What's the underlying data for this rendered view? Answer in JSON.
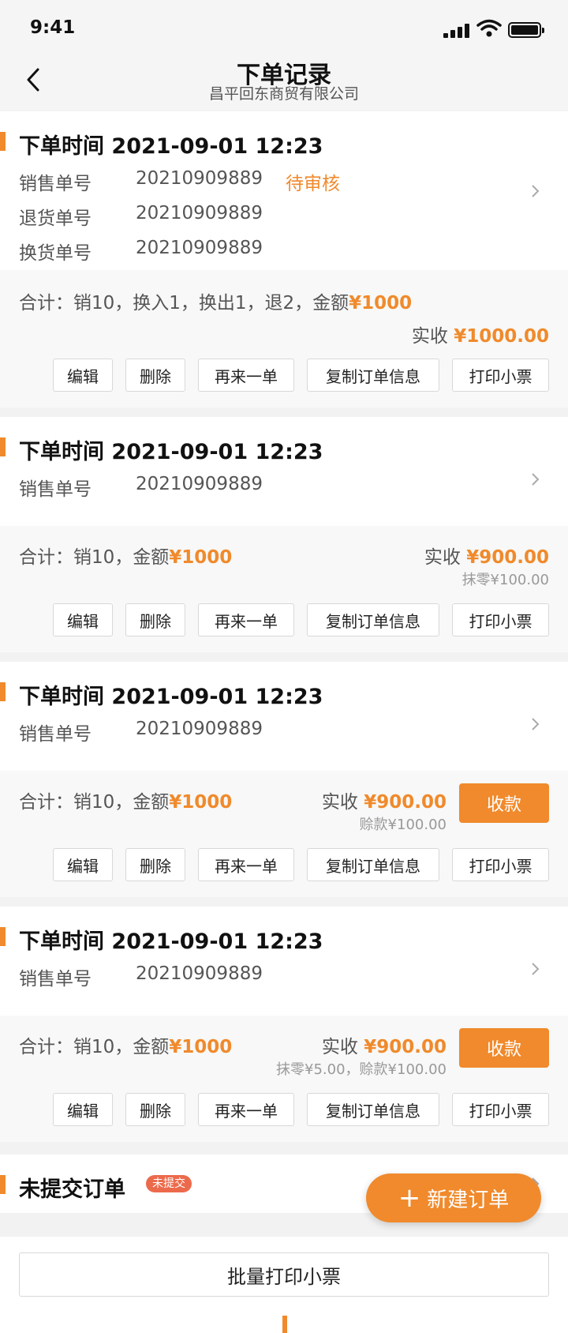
{
  "status": {
    "time": "9:41"
  },
  "nav": {
    "title": "下单记录",
    "subtitle": "昌平回东商贸有限公司"
  },
  "labels": {
    "order_time": "下单时间",
    "sale_no": "销售单号",
    "return_no": "退货单号",
    "exchange_no": "换货单号",
    "actual": "实收"
  },
  "orders": [
    {
      "time": "2021-09-01 12:23",
      "sale_no": "20210909889",
      "status": "待审核",
      "return_no": "20210909889",
      "exchange_no": "20210909889",
      "summary": "合计：销10，换入1，换出1，退2，金额",
      "amount": "¥1000",
      "actual": "¥1000.00",
      "note": ""
    },
    {
      "time": "2021-09-01 12:23",
      "sale_no": "20210909889",
      "summary": "合计：销10，金额",
      "amount": "¥1000",
      "actual": "¥900.00",
      "note": "抹零¥100.00"
    },
    {
      "time": "2021-09-01 12:23",
      "sale_no": "20210909889",
      "summary": "合计：销10，金额",
      "amount": "¥1000",
      "actual": "¥900.00",
      "note": "赊款¥100.00",
      "pay_label": "收款"
    },
    {
      "time": "2021-09-01 12:23",
      "sale_no": "20210909889",
      "summary": "合计：销10，金额",
      "amount": "¥1000",
      "actual": "¥900.00",
      "note": "抹零¥5.00，赊款¥100.00",
      "pay_label": "收款"
    }
  ],
  "buttons": {
    "edit": "编辑",
    "delete": "删除",
    "reorder": "再来一单",
    "copy": "复制订单信息",
    "print": "打印小票"
  },
  "draft": {
    "title": "未提交订单",
    "badge": "未提交"
  },
  "fab": {
    "label": "新建订单"
  },
  "bottom": {
    "batch_print": "批量打印小票"
  },
  "colors": {
    "accent": "#f08a2c",
    "badge": "#ec6a4c"
  }
}
